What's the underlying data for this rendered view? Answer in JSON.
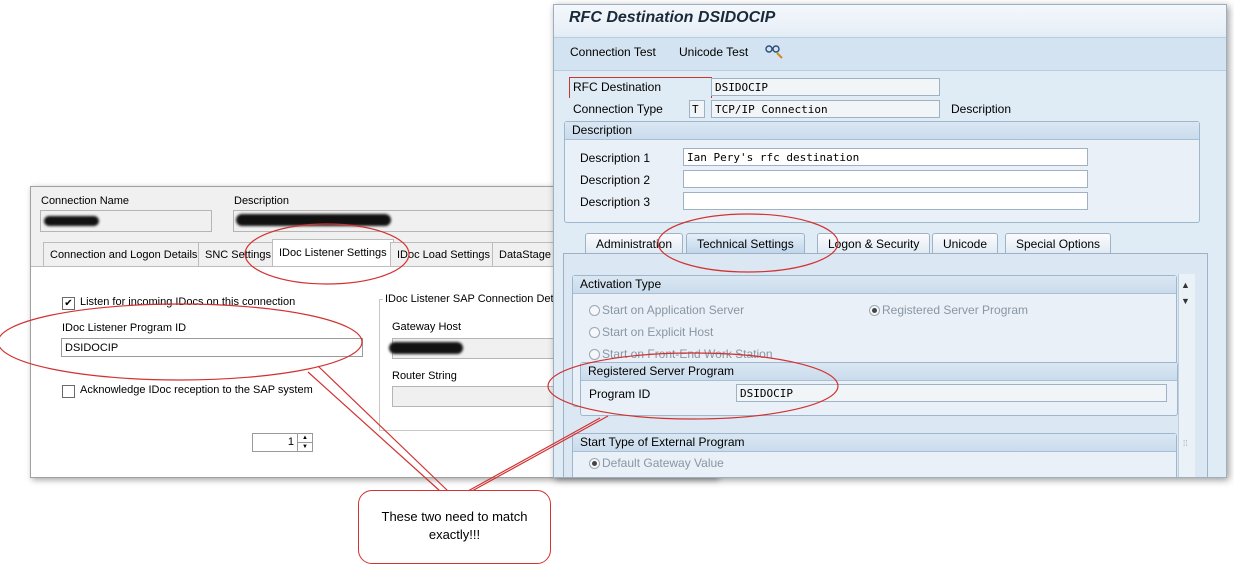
{
  "datastage": {
    "connection_name_label": "Connection Name",
    "description_label": "Description",
    "tabs": [
      {
        "label": "Connection and Logon Details"
      },
      {
        "label": "SNC Settings"
      },
      {
        "label": "IDoc Listener Settings"
      },
      {
        "label": "IDoc Load Settings"
      },
      {
        "label": "DataStage"
      }
    ],
    "listen_checkbox": {
      "label": "Listen for incoming IDocs on this connection",
      "checked": true,
      "mark": "✔"
    },
    "program_id_label": "IDoc Listener Program ID",
    "program_id_value": "DSIDOCIP",
    "acknowledge_checkbox": {
      "label": "Acknowledge IDoc reception to the SAP system",
      "checked": false
    },
    "sap_details_group": "IDoc Listener SAP Connection Det",
    "gateway_host_label": "Gateway Host",
    "router_string_label": "Router String",
    "spinner_value": "1"
  },
  "sap": {
    "title": "RFC Destination DSIDOCIP",
    "toolbar": {
      "connection_test": "Connection Test",
      "unicode_test": "Unicode Test",
      "glasses_icon": "glasses-icon"
    },
    "rfc_destination_label": "RFC Destination",
    "rfc_destination_value": "DSIDOCIP",
    "connection_type_label": "Connection Type",
    "connection_type_code": "T",
    "connection_type_value": "TCP/IP Connection",
    "description_side_label": "Description",
    "description_group": {
      "header": "Description",
      "rows": [
        {
          "label": "Description 1",
          "value": "Ian Pery's rfc destination"
        },
        {
          "label": "Description 2",
          "value": ""
        },
        {
          "label": "Description 3",
          "value": ""
        }
      ]
    },
    "tabs": [
      {
        "label": "Administration"
      },
      {
        "label": "Technical Settings"
      },
      {
        "label": "Logon & Security"
      },
      {
        "label": "Unicode"
      },
      {
        "label": "Special Options"
      }
    ],
    "activation_type": {
      "header": "Activation Type",
      "options": [
        {
          "label": "Start on Application Server",
          "selected": false
        },
        {
          "label": "Start on Explicit Host",
          "selected": false
        },
        {
          "label": "Start on Front-End Work Station",
          "selected": false
        },
        {
          "label": "Registered Server Program",
          "selected": true
        }
      ]
    },
    "registered_server_program": {
      "header": "Registered Server Program",
      "program_id_label": "Program ID",
      "program_id_value": "DSIDOCIP"
    },
    "start_type": {
      "header": "Start Type of External Program",
      "option": "Default Gateway Value"
    }
  },
  "annotation": {
    "callout_line1": "These two need to match",
    "callout_line2": "exactly!!!",
    "color": "#d23232"
  }
}
